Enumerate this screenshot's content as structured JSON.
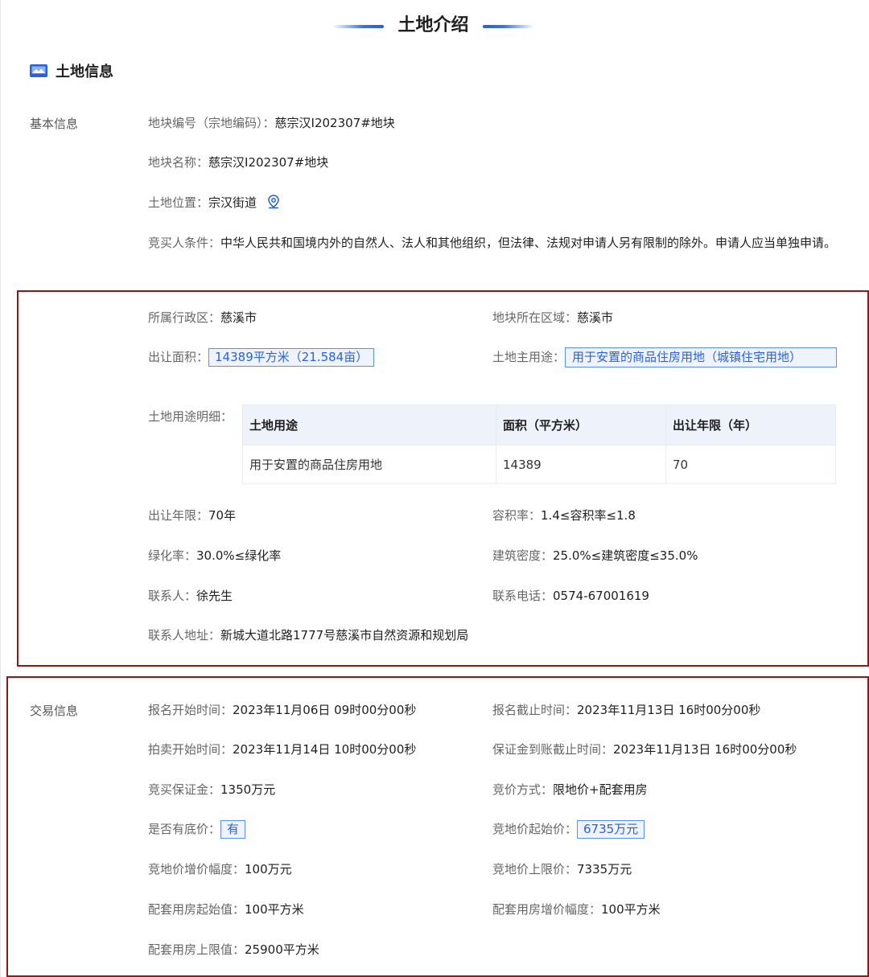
{
  "header": {
    "title": "土地介绍"
  },
  "section": {
    "title": "土地信息",
    "icon": "land-image-icon"
  },
  "basic": {
    "group_label": "基本信息",
    "parcel_code_label": "地块编号（宗地编码）：",
    "parcel_code": "慈宗汉Ⅰ202307#地块",
    "parcel_name_label": "地块名称：",
    "parcel_name": "慈宗汉Ⅰ202307#地块",
    "location_label": "土地位置：",
    "location": "宗汉街道",
    "bidder_label": "竞买人条件：",
    "bidder_text": "中华人民共和国境内外的自然人、法人和其他组织，但法律、法规对申请人另有限制的除外。申请人应当单独申请。"
  },
  "details": {
    "district_label": "所属行政区：",
    "district": "慈溪市",
    "area_region_label": "地块所在区域：",
    "area_region": "慈溪市",
    "transfer_area_label": "出让面积：",
    "transfer_area": "14389平方米（21.584亩）",
    "main_use_label": "土地主用途：",
    "main_use": "用于安置的商品住房用地（城镇住宅用地）",
    "usage_detail_label": "土地用途明细：",
    "usage_table": {
      "headers": [
        "土地用途",
        "面积（平方米）",
        "出让年限（年）"
      ],
      "rows": [
        [
          "用于安置的商品住房用地",
          "14389",
          "70"
        ]
      ]
    },
    "term_label": "出让年限：",
    "term": "70年",
    "far_label": "容积率：",
    "far": "1.4≤容积率≤1.8",
    "green_label": "绿化率：",
    "green": "30.0%≤绿化率",
    "density_label": "建筑密度：",
    "density": "25.0%≤建筑密度≤35.0%",
    "contact_label": "联系人：",
    "contact": "徐先生",
    "phone_label": "联系电话：",
    "phone": "0574-67001619",
    "address_label": "联系人地址：",
    "address": "新城大道北路1777号慈溪市自然资源和规划局"
  },
  "trade": {
    "group_label": "交易信息",
    "signup_start_label": "报名开始时间：",
    "signup_start": "2023年11月06日 09时00分00秒",
    "signup_end_label": "报名截止时间：",
    "signup_end": "2023年11月13日 16时00分00秒",
    "auction_start_label": "拍卖开始时间：",
    "auction_start": "2023年11月14日 10时00分00秒",
    "deposit_deadline_label": "保证金到账截止时间：",
    "deposit_deadline": "2023年11月13日 16时00分00秒",
    "deposit_label": "竞买保证金：",
    "deposit": "1350万元",
    "bid_method_label": "竞价方式：",
    "bid_method": "限地价+配套用房",
    "reserve_label": "是否有底价：",
    "reserve": "有",
    "start_price_label": "竞地价起始价：",
    "start_price": "6735万元",
    "increment_label": "竞地价增价幅度：",
    "increment": "100万元",
    "price_cap_label": "竞地价上限价：",
    "price_cap": "7335万元",
    "housing_start_label": "配套用房起始值：",
    "housing_start": "100平方米",
    "housing_increment_label": "配套用房增价幅度：",
    "housing_increment": "100平方米",
    "housing_cap_label": "配套用房上限值：",
    "housing_cap": "25900平方米"
  },
  "colors": {
    "accent": "#3b71e1",
    "frame": "#8b1a1a",
    "tag_border": "#5b8ff0",
    "tag_bg": "#eef3fd"
  }
}
